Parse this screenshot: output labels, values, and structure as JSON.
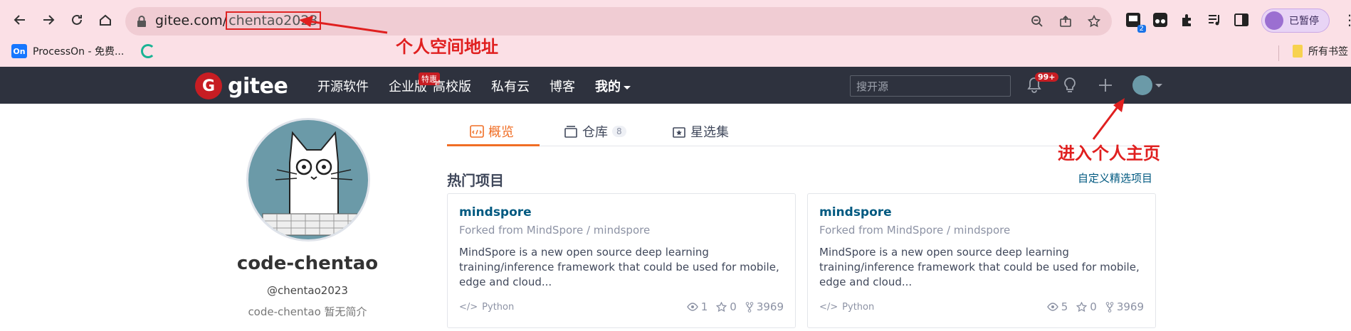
{
  "browser": {
    "url_host": "gitee.com/",
    "url_path": "chentao2023",
    "paused_label": "已暂停",
    "ext_badge": "2",
    "bookmarks": [
      {
        "icon": "On",
        "label": "ProcessOn - 免费..."
      },
      {
        "label": ""
      }
    ],
    "bookmarks_right": "所有书签"
  },
  "annotations": {
    "space_address": "个人空间地址",
    "enter_home": "进入个人主页"
  },
  "gitee_nav": {
    "logo_text": "gitee",
    "links": [
      "开源软件",
      "企业版",
      "高校版",
      "私有云",
      "博客",
      "我的"
    ],
    "enterprise_badge": "特惠",
    "search_placeholder": "搜开源",
    "notif_badge": "99+"
  },
  "profile": {
    "display_name": "code-chentao",
    "handle": "@chentao2023",
    "bio": "code-chentao 暂无简介"
  },
  "tabs": [
    {
      "label": "概览"
    },
    {
      "label": "仓库",
      "count": "8"
    },
    {
      "label": "星选集"
    }
  ],
  "section": {
    "title": "热门项目",
    "link": "自定义精选项目"
  },
  "cards": [
    {
      "name": "mindspore",
      "fork": "Forked from MindSpore  / mindspore",
      "desc": "MindSpore is a new open source deep learning training/inference framework that could be used for mobile, edge and cloud...",
      "lang": "Python",
      "watch": "1",
      "star": "0",
      "forks": "3969"
    },
    {
      "name": "mindspore",
      "fork": "Forked from MindSpore  / mindspore",
      "desc": "MindSpore is a new open source deep learning training/inference framework that could be used for mobile, edge and cloud...",
      "lang": "Python",
      "watch": "5",
      "star": "0",
      "forks": "3969"
    }
  ]
}
